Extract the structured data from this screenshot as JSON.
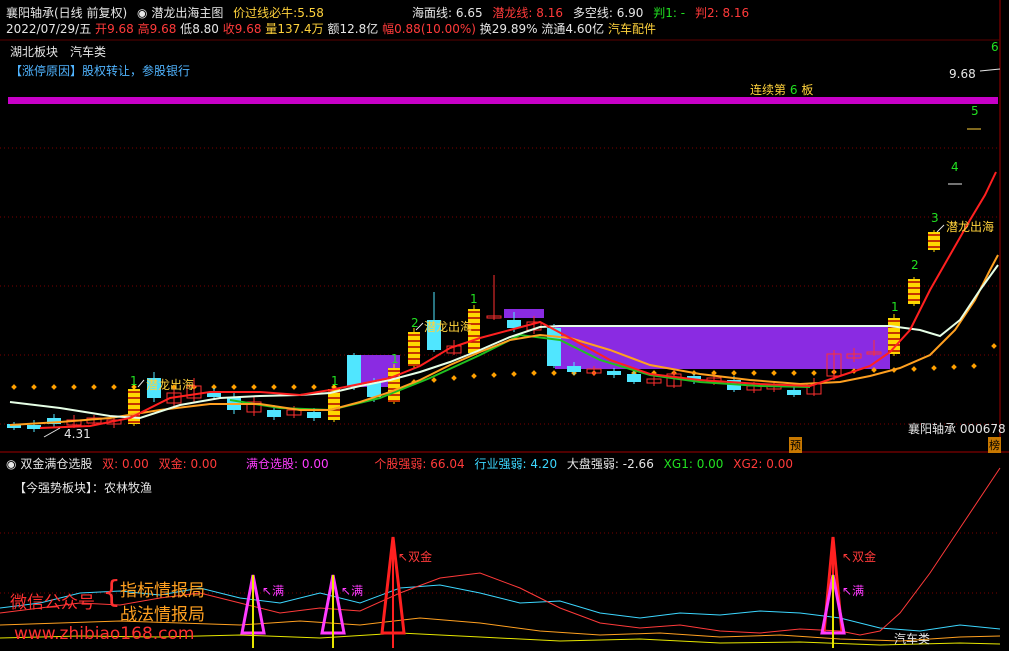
{
  "header": {
    "stock_title": "襄阳轴承(日线 前复权)",
    "indicator_name": "潜龙出海主图",
    "price_break_label": "价过线必牛:",
    "price_break_value": "5.58",
    "sea_line_label": "海面线:",
    "sea_line_value": "6.65",
    "dragon_line_label": "潜龙线:",
    "dragon_line_value": "8.16",
    "bullbear_label": "多空线:",
    "bullbear_value": "6.90",
    "judge1_label": "判1:",
    "judge1_value": "-",
    "judge2_label": "判2:",
    "judge2_value": "8.16"
  },
  "quote": {
    "date": "2022/07/29/五",
    "open_label": "开",
    "open": "9.68",
    "high_label": "高",
    "high": "9.68",
    "low_label": "低",
    "low": "8.80",
    "close_label": "收",
    "close": "9.68",
    "volume_label": "量",
    "volume": "137.4万",
    "amount_label": "额",
    "amount": "12.8亿",
    "change_label": "幅",
    "change": "0.88(10.00%)",
    "turnover_label": "换",
    "turnover": "29.89%",
    "float_label": "流通",
    "float": "4.60亿",
    "industry": "汽车配件"
  },
  "blocks": {
    "region": "湖北板块",
    "sector": "汽车类",
    "limit_reason": "【涨停原因】股权转让，参股银行"
  },
  "main_chart": {
    "consecutive_prefix": "连续第",
    "consecutive_num": "6",
    "consecutive_suffix": "板",
    "price_tag": "9.68",
    "low_price": "4.31",
    "stock_name_code": "襄阳轴承  000678",
    "pre_badge": "预",
    "rank_badge": "榜",
    "dragon_labels": [
      "潜龙出海",
      "潜龙出海",
      "潜龙出海"
    ],
    "board_counts": [
      "1",
      "1",
      "1",
      "2",
      "1",
      "1",
      "2",
      "3",
      "4",
      "5",
      "6",
      "1"
    ],
    "colors": {
      "up": "#ffd700",
      "down": "#50e6ff",
      "magenta": "#c800c8",
      "purple": "#8a2be2",
      "red_line": "#ff2020",
      "white_line": "#e6ffe6",
      "orange_line": "#ffa020",
      "green_line": "#20c020",
      "dots": "#ffa000"
    }
  },
  "sub_chart": {
    "title": "双金满仓选股",
    "dual_label": "双:",
    "dual_value": "0.00",
    "dual_gold_label": "双金:",
    "dual_gold_value": "0.00",
    "full_label": "满仓选股:",
    "full_value": "0.00",
    "stock_strength_label": "个股强弱:",
    "stock_strength_value": "66.04",
    "industry_strength_label": "行业强弱:",
    "industry_strength_value": "4.20",
    "market_strength_label": "大盘强弱:",
    "market_strength_value": "-2.66",
    "xg1_label": "XG1:",
    "xg1_value": "0.00",
    "xg2_label": "XG2:",
    "xg2_value": "0.00",
    "strong_sector": "【今强势板块】：农林牧渔",
    "full_marks": [
      "满",
      "满",
      "满"
    ],
    "gold_marks": [
      "双金",
      "双金"
    ],
    "sector_tag": "汽车类"
  },
  "watermark": {
    "wechat": "微信公众号",
    "brand1": "指标情报局",
    "brand2": "战法情报局",
    "site": "www.zhibiao168.com"
  }
}
